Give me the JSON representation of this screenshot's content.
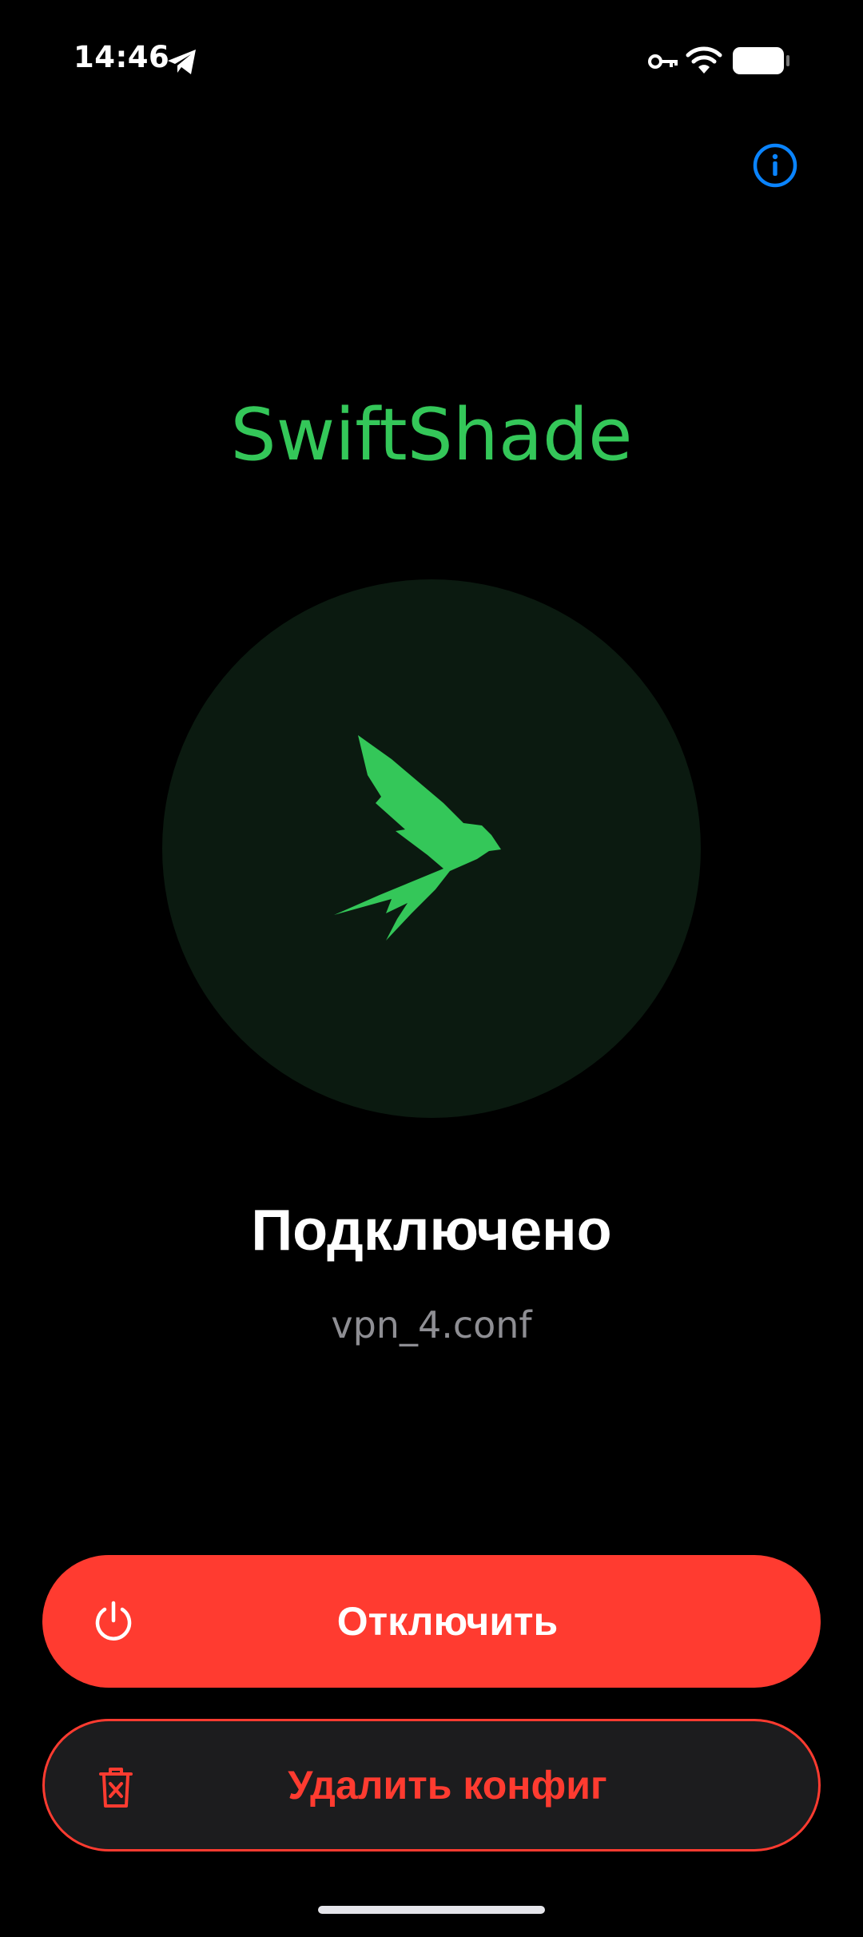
{
  "status_bar": {
    "time": "14:46",
    "icons": [
      "telegram-icon",
      "vpn-key-icon",
      "wifi-icon",
      "battery-icon"
    ]
  },
  "header": {
    "info_icon": "info-icon"
  },
  "app": {
    "title": "SwiftShade"
  },
  "connection": {
    "status": "Подключено",
    "config_name": "vpn_4.conf",
    "logo_icon": "swift-bird-icon"
  },
  "actions": {
    "disconnect_label": "Отключить",
    "delete_label": "Удалить конфиг"
  },
  "colors": {
    "accent_green": "#34c759",
    "danger_red": "#ff3b30",
    "info_blue": "#0a84ff",
    "background": "#000000",
    "circle_bg": "#0b1a10",
    "secondary_text": "#8e8e93"
  }
}
